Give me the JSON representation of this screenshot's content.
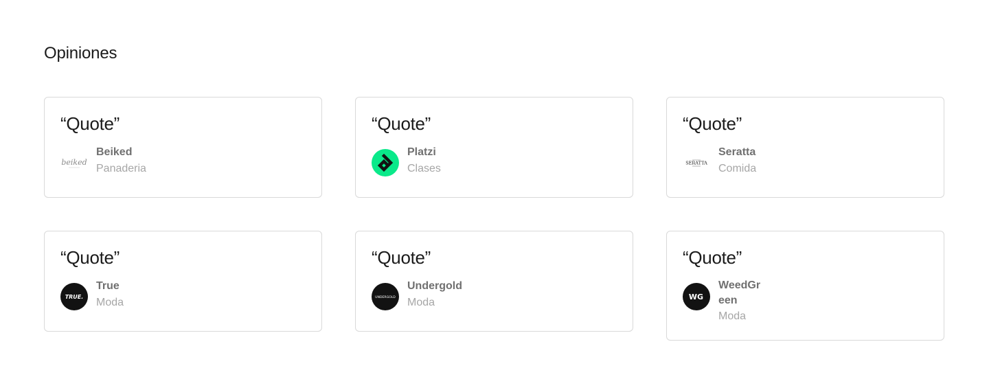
{
  "section": {
    "title": "Opiniones"
  },
  "testimonials": [
    {
      "quote": "“Quote”",
      "name": "Beiked",
      "category": "Panaderia",
      "logo": "beiked-logo"
    },
    {
      "quote": "“Quote”",
      "name": "Platzi",
      "category": "Clases",
      "logo": "platzi-logo"
    },
    {
      "quote": "“Quote”",
      "name": "Seratta",
      "category": "Comida",
      "logo": "seratta-logo"
    },
    {
      "quote": "“Quote”",
      "name": "True",
      "category": "Moda",
      "logo": "true-logo"
    },
    {
      "quote": "“Quote”",
      "name": "Undergold",
      "category": "Moda",
      "logo": "undergold-logo"
    },
    {
      "quote": "“Quote”",
      "name": "WeedGreen",
      "category": "Moda",
      "logo": "weedgreen-logo"
    }
  ],
  "logo_text": {
    "beiked": "beiked",
    "seratta": "SERATTA",
    "true": "TRUE.",
    "undergold": "UNDERGOLD",
    "weedgreen": "WG"
  },
  "colors": {
    "card_border": "#d9d9d9",
    "name": "#707070",
    "category": "#a6a6a6",
    "platzi_green": "#0ae98a",
    "logo_dark": "#121212"
  }
}
